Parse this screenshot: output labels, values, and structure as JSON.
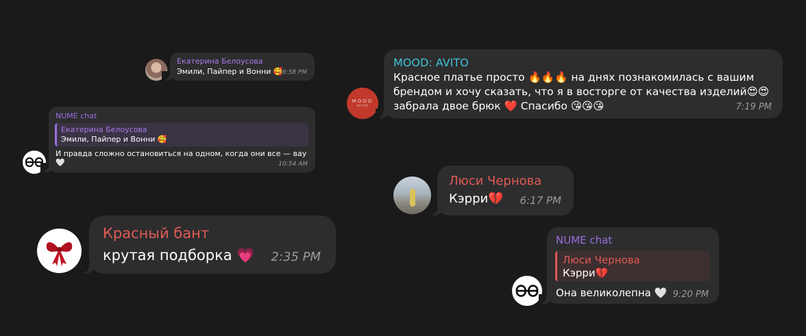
{
  "colors": {
    "background": "#1a1a1a",
    "bubble": "#2d2d2e",
    "nume_purple": "#9a6ee0",
    "ekaterina_purple": "#a67be8",
    "mood_teal": "#3ec3d6",
    "red_name": "#e05a55",
    "time_gray": "#9a9a9a"
  },
  "messages": [
    {
      "sender": "Екатерина Белоусова",
      "text": "Эмили, Пайпер и Вонни 🥰",
      "time": "6:58 PM",
      "avatar_icon": "user-photo"
    },
    {
      "sender": "NUME chat",
      "quote_sender": "Екатерина Белоусова",
      "quote_text": "Эмили, Пайпер и Вонни 🥰",
      "text": "И правда сложно остановиться на одном, когда они все — вау 🤍",
      "time": "10:54 AM",
      "avatar_icon": "nume-logo-icon"
    },
    {
      "sender": "Красный бант",
      "text": "крутая подборка 💗",
      "time": "2:35 PM",
      "avatar_icon": "red-bow-icon"
    },
    {
      "sender": "MOOD: AVITO",
      "line1": "Красное платье просто 🔥🔥🔥 на днях познакомилась с вашим",
      "line2": "брендом и хочу сказать, что я в восторге от качества изделий😍😍",
      "line3": "забрала двое брюк ❤️ Спасибо 😘😘😘",
      "time": "7:19 PM",
      "avatar_text_top": "MOOD",
      "avatar_text_bottom": "AVITO"
    },
    {
      "sender": "Люси Чернова",
      "text": "Кэрри💔",
      "time": "6:17 PM",
      "avatar_icon": "user-photo"
    },
    {
      "sender": "NUME chat",
      "quote_sender": "Люси Чернова",
      "quote_text": "Кэрри💔",
      "text": "Она великолепна 🤍",
      "time": "9:20 PM",
      "avatar_icon": "nume-logo-icon"
    }
  ]
}
